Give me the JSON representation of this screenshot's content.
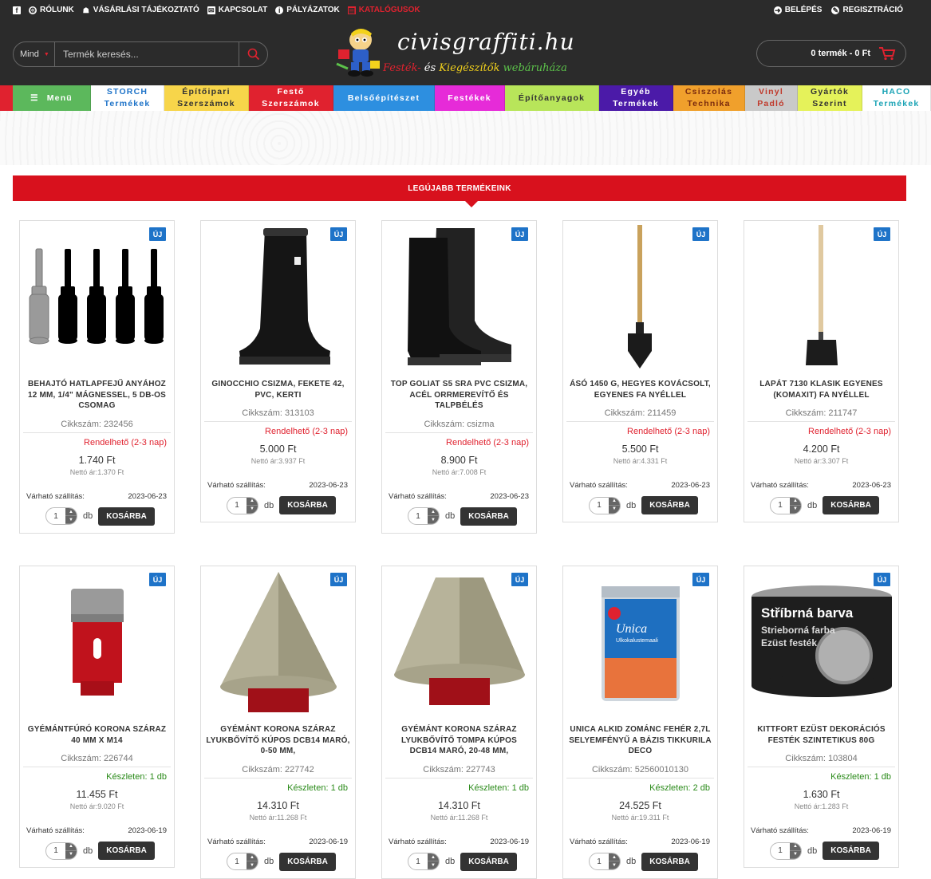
{
  "topbar": {
    "left": [
      {
        "label": "",
        "icon": "facebook-icon"
      },
      {
        "label": "RÓLUNK",
        "icon": "info-person-icon"
      },
      {
        "label": "VÁSÁRLÁSI TÁJÉKOZTATÓ",
        "icon": "cart-icon"
      },
      {
        "label": "KAPCSOLAT",
        "icon": "envelope-icon"
      },
      {
        "label": "PÁLYÁZATOK",
        "icon": "info-icon"
      },
      {
        "label": "KATALÓGUSOK",
        "icon": "book-icon"
      }
    ],
    "right": [
      {
        "label": "BELÉPÉS",
        "icon": "login-icon"
      },
      {
        "label": "REGISZTRÁCIÓ",
        "icon": "register-icon"
      }
    ]
  },
  "header": {
    "search_scope": "Mind",
    "search_placeholder": "Termék keresés...",
    "logo_name": "civisgraffiti.hu",
    "logo_tag_1": "Festék-",
    "logo_tag_2": "és",
    "logo_tag_3": "Kiegészítők",
    "logo_tag_4": "webáruháza",
    "cart_label": "0 termék - 0 Ft"
  },
  "categories": [
    {
      "l1": "Menü",
      "l2": "",
      "bg": "#5cb85c",
      "fg": "#ffffff"
    },
    {
      "l1": "STORCH",
      "l2": "Termékek",
      "bg": "#ffffff",
      "fg": "#1e73c8"
    },
    {
      "l1": "Építőipari",
      "l2": "Szerszámok",
      "bg": "#f7d54a",
      "fg": "#333333"
    },
    {
      "l1": "Festő",
      "l2": "Szerszámok",
      "bg": "#e0222f",
      "fg": "#ffffff"
    },
    {
      "l1": "Belsőépítészet",
      "l2": "",
      "bg": "#2d8fe0",
      "fg": "#ffffff"
    },
    {
      "l1": "Festékek",
      "l2": "",
      "bg": "#e62bd8",
      "fg": "#ffffff"
    },
    {
      "l1": "Építőanyagok",
      "l2": "",
      "bg": "#b8e55a",
      "fg": "#333333"
    },
    {
      "l1": "Egyéb",
      "l2": "Termékek",
      "bg": "#4b1aa8",
      "fg": "#ffffff"
    },
    {
      "l1": "Csiszolás",
      "l2": "Technika",
      "bg": "#f0a02c",
      "fg": "#7a2b0e"
    },
    {
      "l1": "Vinyl",
      "l2": "Padló",
      "bg": "#c9c9c9",
      "fg": "#c0392b"
    },
    {
      "l1": "Gyártók",
      "l2": "Szerint",
      "bg": "#e5f25a",
      "fg": "#333333"
    },
    {
      "l1": "HACO",
      "l2": "Termékek",
      "bg": "#ffffff",
      "fg": "#1aa3b5"
    }
  ],
  "section_title": "LEGÚJABB TERMÉKEINK",
  "labels": {
    "badge": "ÚJ",
    "ship_label": "Várható szállítás:",
    "db": "db",
    "add_to_cart": "KOSÁRBA"
  },
  "products": [
    {
      "name": "BEHAJTÓ HATLAPFEJŰ ANYÁHOZ 12 MM, 1/4\" MÁGNESSEL, 5 DB-OS CSOMAG",
      "sku": "Cikkszám: 232456",
      "stock": "Rendelhető (2-3 nap)",
      "stock_state": "red",
      "price": "1.740 Ft",
      "netto": "Nettó ár:1.370 Ft",
      "ship_date": "2023-06-23",
      "qty": "1",
      "image": "nut-driver-set-icon"
    },
    {
      "name": "GINOCCHIO CSIZMA, FEKETE 42, PVC, KERTI",
      "sku": "Cikkszám: 313103",
      "stock": "Rendelhető (2-3 nap)",
      "stock_state": "red",
      "price": "5.000 Ft",
      "netto": "Nettó ár:3.937 Ft",
      "ship_date": "2023-06-23",
      "qty": "1",
      "image": "boot-icon"
    },
    {
      "name": "TOP GOLIAT S5 SRA PVC CSIZMA, ACÉL ORRMEREVÍTŐ ÉS TALPBÉLÉS",
      "sku": "Cikkszám: csizma",
      "stock": "Rendelhető (2-3 nap)",
      "stock_state": "red",
      "price": "8.900 Ft",
      "netto": "Nettó ár:7.008 Ft",
      "ship_date": "2023-06-23",
      "qty": "1",
      "image": "boots-pair-icon"
    },
    {
      "name": "ÁSÓ 1450 G, HEGYES KOVÁCSOLT, EGYENES FA NYÉLLEL",
      "sku": "Cikkszám: 211459",
      "stock": "Rendelhető (2-3 nap)",
      "stock_state": "red",
      "price": "5.500 Ft",
      "netto": "Nettó ár:4.331 Ft",
      "ship_date": "2023-06-23",
      "qty": "1",
      "image": "spade-icon"
    },
    {
      "name": "LAPÁT 7130 KLASIK EGYENES (KOMAXIT) FA NYÉLLEL",
      "sku": "Cikkszám: 211747",
      "stock": "Rendelhető (2-3 nap)",
      "stock_state": "red",
      "price": "4.200 Ft",
      "netto": "Nettó ár:3.307 Ft",
      "ship_date": "2023-06-23",
      "qty": "1",
      "image": "shovel-icon"
    },
    {
      "name": "GYÉMÁNTFÚRÓ KORONA SZÁRAZ 40 MM X M14",
      "sku": "Cikkszám: 226744",
      "stock": "Készleten: 1 db",
      "stock_state": "green",
      "price": "11.455 Ft",
      "netto": "Nettó ár:9.020 Ft",
      "ship_date": "2023-06-19",
      "qty": "1",
      "image": "core-bit-icon"
    },
    {
      "name": "GYÉMÁNT KORONA SZÁRAZ LYUKBŐVÍTŐ KÚPOS DCB14 MARÓ, 0-50 MM,",
      "sku": "Cikkszám: 227742",
      "stock": "Készleten: 1 db",
      "stock_state": "green",
      "price": "14.310 Ft",
      "netto": "Nettó ár:11.268 Ft",
      "ship_date": "2023-06-19",
      "qty": "1",
      "image": "cone-bit-icon"
    },
    {
      "name": "GYÉMÁNT KORONA SZÁRAZ LYUKBŐVÍTŐ TOMPA KÚPOS DCB14 MARÓ, 20-48 MM,",
      "sku": "Cikkszám: 227743",
      "stock": "Készleten: 1 db",
      "stock_state": "green",
      "price": "14.310 Ft",
      "netto": "Nettó ár:11.268 Ft",
      "ship_date": "2023-06-19",
      "qty": "1",
      "image": "blunt-cone-bit-icon"
    },
    {
      "name": "UNICA ALKID ZOMÁNC FEHÉR 2,7L SELYEMFÉNYŰ A BÁZIS TIKKURILA DECO",
      "sku": "Cikkszám: 52560010130",
      "stock": "Készleten: 2 db",
      "stock_state": "green",
      "price": "24.525 Ft",
      "netto": "Nettó ár:19.311 Ft",
      "ship_date": "2023-06-19",
      "qty": "1",
      "image": "paint-can-icon"
    },
    {
      "name": "KITTFORT EZÜST DEKORÁCIÓS FESTÉK SZINTETIKUS 80G",
      "sku": "Cikkszám: 103804",
      "stock": "Készleten: 1 db",
      "stock_state": "green",
      "price": "1.630 Ft",
      "netto": "Nettó ár:1.283 Ft",
      "ship_date": "2023-06-19",
      "qty": "1",
      "image": "silver-paint-tin-icon"
    }
  ],
  "product_images": {
    "unica_brand": "Unica",
    "unica_sub": "Ulkokalustemaali",
    "kittfort_line1": "Stříbrná barva",
    "kittfort_line2": "Strieborná farba",
    "kittfort_line3": "Ezüst festék"
  },
  "colors": {
    "brand_red": "#e0222f",
    "dark": "#2b2b2b",
    "badge_blue": "#1e73c8",
    "stock_green": "#2a8a19"
  }
}
